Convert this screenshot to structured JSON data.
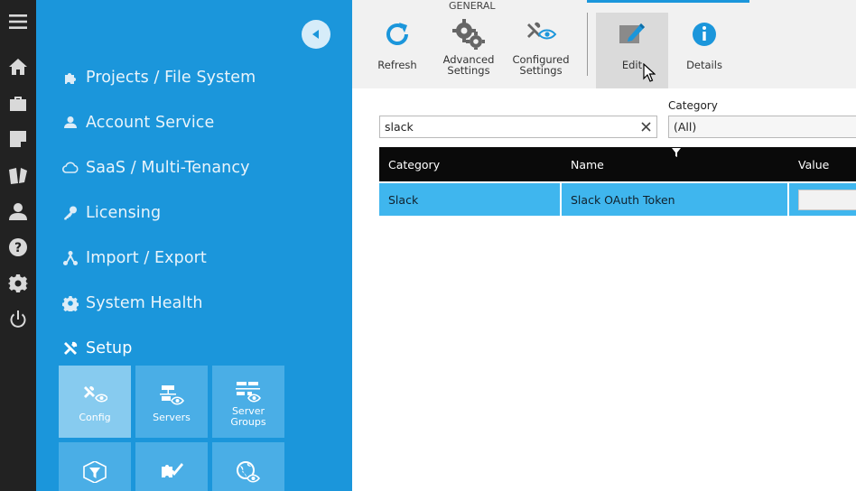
{
  "rail": {
    "items": [
      "menu-icon",
      "home-icon",
      "briefcase-icon",
      "note-icon",
      "book-icon",
      "user-icon",
      "help-icon",
      "gear-icon",
      "power-icon"
    ]
  },
  "nav": {
    "items": [
      {
        "label": "Projects / File System",
        "icon": "puzzle-icon"
      },
      {
        "label": "Account Service",
        "icon": "user-icon"
      },
      {
        "label": "SaaS / Multi-Tenancy",
        "icon": "cloud-icon"
      },
      {
        "label": "Licensing",
        "icon": "key-icon"
      },
      {
        "label": "Import / Export",
        "icon": "import-export-icon"
      },
      {
        "label": "System Health",
        "icon": "gear-icon"
      },
      {
        "label": "Setup",
        "icon": "tools-icon"
      }
    ],
    "tiles": [
      {
        "label": "Config",
        "icon": "config-icon"
      },
      {
        "label": "Servers",
        "icon": "servers-icon"
      },
      {
        "label": "Server Groups",
        "icon": "server-groups-icon"
      },
      {
        "label": "",
        "icon": "filter-icon"
      },
      {
        "label": "",
        "icon": "puzzle-brush-icon"
      },
      {
        "label": "",
        "icon": "globe-eye-icon"
      }
    ]
  },
  "ribbon": {
    "group_title": "GENERAL",
    "buttons": {
      "refresh": "Refresh",
      "advanced": "Advanced Settings",
      "configured": "Configured Settings",
      "edit": "Edit",
      "details": "Details"
    }
  },
  "filters": {
    "search_value": "slack",
    "category_label": "Category",
    "category_value": "(All)"
  },
  "grid": {
    "columns": [
      "Category",
      "Name",
      "Value"
    ],
    "rows": [
      {
        "category": "Slack",
        "name": "Slack OAuth Token",
        "value": ""
      }
    ]
  },
  "colors": {
    "nav_bg": "#1b96db",
    "rail_bg": "#222222",
    "row_selected": "#3fb6ee",
    "grid_header": "#0a0a0a"
  }
}
